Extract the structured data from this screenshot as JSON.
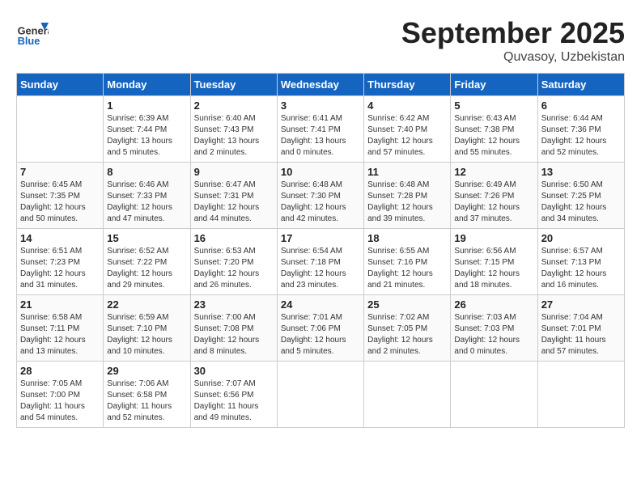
{
  "header": {
    "logo_general": "General",
    "logo_blue": "Blue",
    "month_title": "September 2025",
    "location": "Quvasoy, Uzbekistan"
  },
  "days_of_week": [
    "Sunday",
    "Monday",
    "Tuesday",
    "Wednesday",
    "Thursday",
    "Friday",
    "Saturday"
  ],
  "weeks": [
    [
      {
        "day": "",
        "info": ""
      },
      {
        "day": "1",
        "info": "Sunrise: 6:39 AM\nSunset: 7:44 PM\nDaylight: 13 hours\nand 5 minutes."
      },
      {
        "day": "2",
        "info": "Sunrise: 6:40 AM\nSunset: 7:43 PM\nDaylight: 13 hours\nand 2 minutes."
      },
      {
        "day": "3",
        "info": "Sunrise: 6:41 AM\nSunset: 7:41 PM\nDaylight: 13 hours\nand 0 minutes."
      },
      {
        "day": "4",
        "info": "Sunrise: 6:42 AM\nSunset: 7:40 PM\nDaylight: 12 hours\nand 57 minutes."
      },
      {
        "day": "5",
        "info": "Sunrise: 6:43 AM\nSunset: 7:38 PM\nDaylight: 12 hours\nand 55 minutes."
      },
      {
        "day": "6",
        "info": "Sunrise: 6:44 AM\nSunset: 7:36 PM\nDaylight: 12 hours\nand 52 minutes."
      }
    ],
    [
      {
        "day": "7",
        "info": "Sunrise: 6:45 AM\nSunset: 7:35 PM\nDaylight: 12 hours\nand 50 minutes."
      },
      {
        "day": "8",
        "info": "Sunrise: 6:46 AM\nSunset: 7:33 PM\nDaylight: 12 hours\nand 47 minutes."
      },
      {
        "day": "9",
        "info": "Sunrise: 6:47 AM\nSunset: 7:31 PM\nDaylight: 12 hours\nand 44 minutes."
      },
      {
        "day": "10",
        "info": "Sunrise: 6:48 AM\nSunset: 7:30 PM\nDaylight: 12 hours\nand 42 minutes."
      },
      {
        "day": "11",
        "info": "Sunrise: 6:48 AM\nSunset: 7:28 PM\nDaylight: 12 hours\nand 39 minutes."
      },
      {
        "day": "12",
        "info": "Sunrise: 6:49 AM\nSunset: 7:26 PM\nDaylight: 12 hours\nand 37 minutes."
      },
      {
        "day": "13",
        "info": "Sunrise: 6:50 AM\nSunset: 7:25 PM\nDaylight: 12 hours\nand 34 minutes."
      }
    ],
    [
      {
        "day": "14",
        "info": "Sunrise: 6:51 AM\nSunset: 7:23 PM\nDaylight: 12 hours\nand 31 minutes."
      },
      {
        "day": "15",
        "info": "Sunrise: 6:52 AM\nSunset: 7:22 PM\nDaylight: 12 hours\nand 29 minutes."
      },
      {
        "day": "16",
        "info": "Sunrise: 6:53 AM\nSunset: 7:20 PM\nDaylight: 12 hours\nand 26 minutes."
      },
      {
        "day": "17",
        "info": "Sunrise: 6:54 AM\nSunset: 7:18 PM\nDaylight: 12 hours\nand 23 minutes."
      },
      {
        "day": "18",
        "info": "Sunrise: 6:55 AM\nSunset: 7:16 PM\nDaylight: 12 hours\nand 21 minutes."
      },
      {
        "day": "19",
        "info": "Sunrise: 6:56 AM\nSunset: 7:15 PM\nDaylight: 12 hours\nand 18 minutes."
      },
      {
        "day": "20",
        "info": "Sunrise: 6:57 AM\nSunset: 7:13 PM\nDaylight: 12 hours\nand 16 minutes."
      }
    ],
    [
      {
        "day": "21",
        "info": "Sunrise: 6:58 AM\nSunset: 7:11 PM\nDaylight: 12 hours\nand 13 minutes."
      },
      {
        "day": "22",
        "info": "Sunrise: 6:59 AM\nSunset: 7:10 PM\nDaylight: 12 hours\nand 10 minutes."
      },
      {
        "day": "23",
        "info": "Sunrise: 7:00 AM\nSunset: 7:08 PM\nDaylight: 12 hours\nand 8 minutes."
      },
      {
        "day": "24",
        "info": "Sunrise: 7:01 AM\nSunset: 7:06 PM\nDaylight: 12 hours\nand 5 minutes."
      },
      {
        "day": "25",
        "info": "Sunrise: 7:02 AM\nSunset: 7:05 PM\nDaylight: 12 hours\nand 2 minutes."
      },
      {
        "day": "26",
        "info": "Sunrise: 7:03 AM\nSunset: 7:03 PM\nDaylight: 12 hours\nand 0 minutes."
      },
      {
        "day": "27",
        "info": "Sunrise: 7:04 AM\nSunset: 7:01 PM\nDaylight: 11 hours\nand 57 minutes."
      }
    ],
    [
      {
        "day": "28",
        "info": "Sunrise: 7:05 AM\nSunset: 7:00 PM\nDaylight: 11 hours\nand 54 minutes."
      },
      {
        "day": "29",
        "info": "Sunrise: 7:06 AM\nSunset: 6:58 PM\nDaylight: 11 hours\nand 52 minutes."
      },
      {
        "day": "30",
        "info": "Sunrise: 7:07 AM\nSunset: 6:56 PM\nDaylight: 11 hours\nand 49 minutes."
      },
      {
        "day": "",
        "info": ""
      },
      {
        "day": "",
        "info": ""
      },
      {
        "day": "",
        "info": ""
      },
      {
        "day": "",
        "info": ""
      }
    ]
  ]
}
